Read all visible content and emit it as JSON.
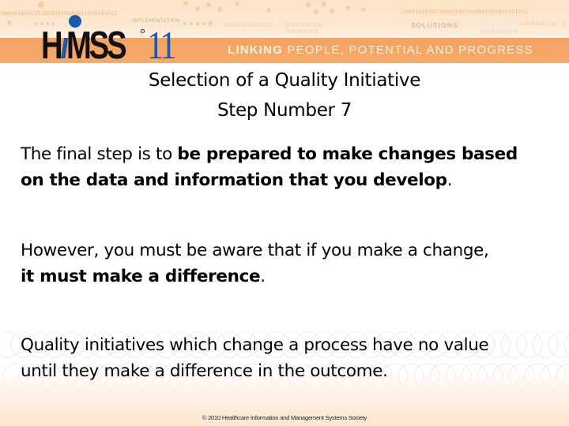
{
  "header": {
    "logo": {
      "brand": "HiMSS",
      "edition": "11",
      "registered_mark": "®"
    },
    "binary_left": "00010102023510203030100011010101011",
    "binary_right": "10001010202303020101010001101010101011",
    "implementation_label": "IMPLEMENTATION",
    "solutions_label": "SOLUTIONS",
    "tagline_strong": "LINKING",
    "tagline_rest": " PEOPLE, POTENTIAL AND PROGRESS",
    "colors": {
      "orange_band": "#f4a261",
      "logo_blue": "#1f56a8",
      "logo_black": "#111111"
    }
  },
  "slide": {
    "title_line1": "Selection of a Quality Initiative",
    "title_line2": "Step Number 7",
    "paragraphs": [
      {
        "line1_normal": "The final step is to ",
        "line1_bold": "be prepared to make changes based",
        "line2_bold": "on the data and information that you develop",
        "line2_tail": "."
      },
      {
        "line1_normal": "However, you must be aware that if you make a change,",
        "line2_bold": "it must make a difference",
        "line2_tail": "."
      },
      {
        "line1_normal": "Quality initiatives which change a process have no value",
        "line2_normal": "until they make a difference in the outcome."
      }
    ]
  },
  "footer": {
    "copyright": "© 2010 Healthcare Information and Management Systems Society"
  }
}
